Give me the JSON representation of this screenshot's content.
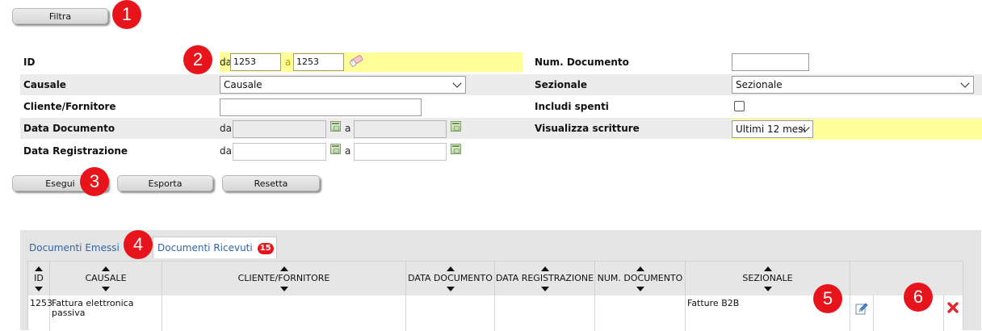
{
  "buttons": {
    "filter": "Filtra",
    "run": "Esegui",
    "export": "Esporta",
    "reset": "Resetta"
  },
  "badges": [
    "1",
    "2",
    "3",
    "4",
    "5",
    "6"
  ],
  "filters": {
    "id": {
      "label": "ID",
      "from_label": "da",
      "from_value": "1253",
      "to_label": "a",
      "to_value": "1253"
    },
    "causale": {
      "label": "Causale",
      "value": "Causale"
    },
    "cliente": {
      "label": "Cliente/Fornitore",
      "value": ""
    },
    "data_documento": {
      "label": "Data Documento",
      "from_label": "da",
      "to_label": "a"
    },
    "data_registrazione": {
      "label": "Data Registrazione",
      "from_label": "da",
      "to_label": "a"
    },
    "num_documento": {
      "label": "Num. Documento",
      "value": ""
    },
    "sezionale": {
      "label": "Sezionale",
      "value": "Sezionale"
    },
    "includi_spenti": {
      "label": "Includi spenti",
      "checked": false
    },
    "visualizza_scritture": {
      "label": "Visualizza scritture",
      "value": "Ultimi 12 mesi"
    }
  },
  "tabs": [
    {
      "label": "Documenti Emessi"
    },
    {
      "label": "Documenti Ricevuti",
      "count": "15"
    }
  ],
  "table": {
    "columns": [
      "ID",
      "CAUSALE",
      "CLIENTE/FORNITORE",
      "DATA DOCUMENTO",
      "DATA REGISTRAZIONE",
      "NUM. DOCUMENTO",
      "SEZIONALE"
    ],
    "rows": [
      {
        "id": "1253",
        "causale": "Fattura elettronica passiva",
        "cliente": "",
        "data_documento": "",
        "data_registrazione": "",
        "num_documento": "",
        "sezionale": "Fatture B2B"
      }
    ]
  },
  "icons": {
    "edit": "pencil-icon",
    "delete": "delete-x-icon",
    "eraser": "eraser-icon",
    "calendar": "calendar-icon"
  },
  "colors": {
    "highlight": "#ffff99",
    "badge": "#e8141c",
    "link": "#3164a6",
    "delete": "#e3262b"
  }
}
